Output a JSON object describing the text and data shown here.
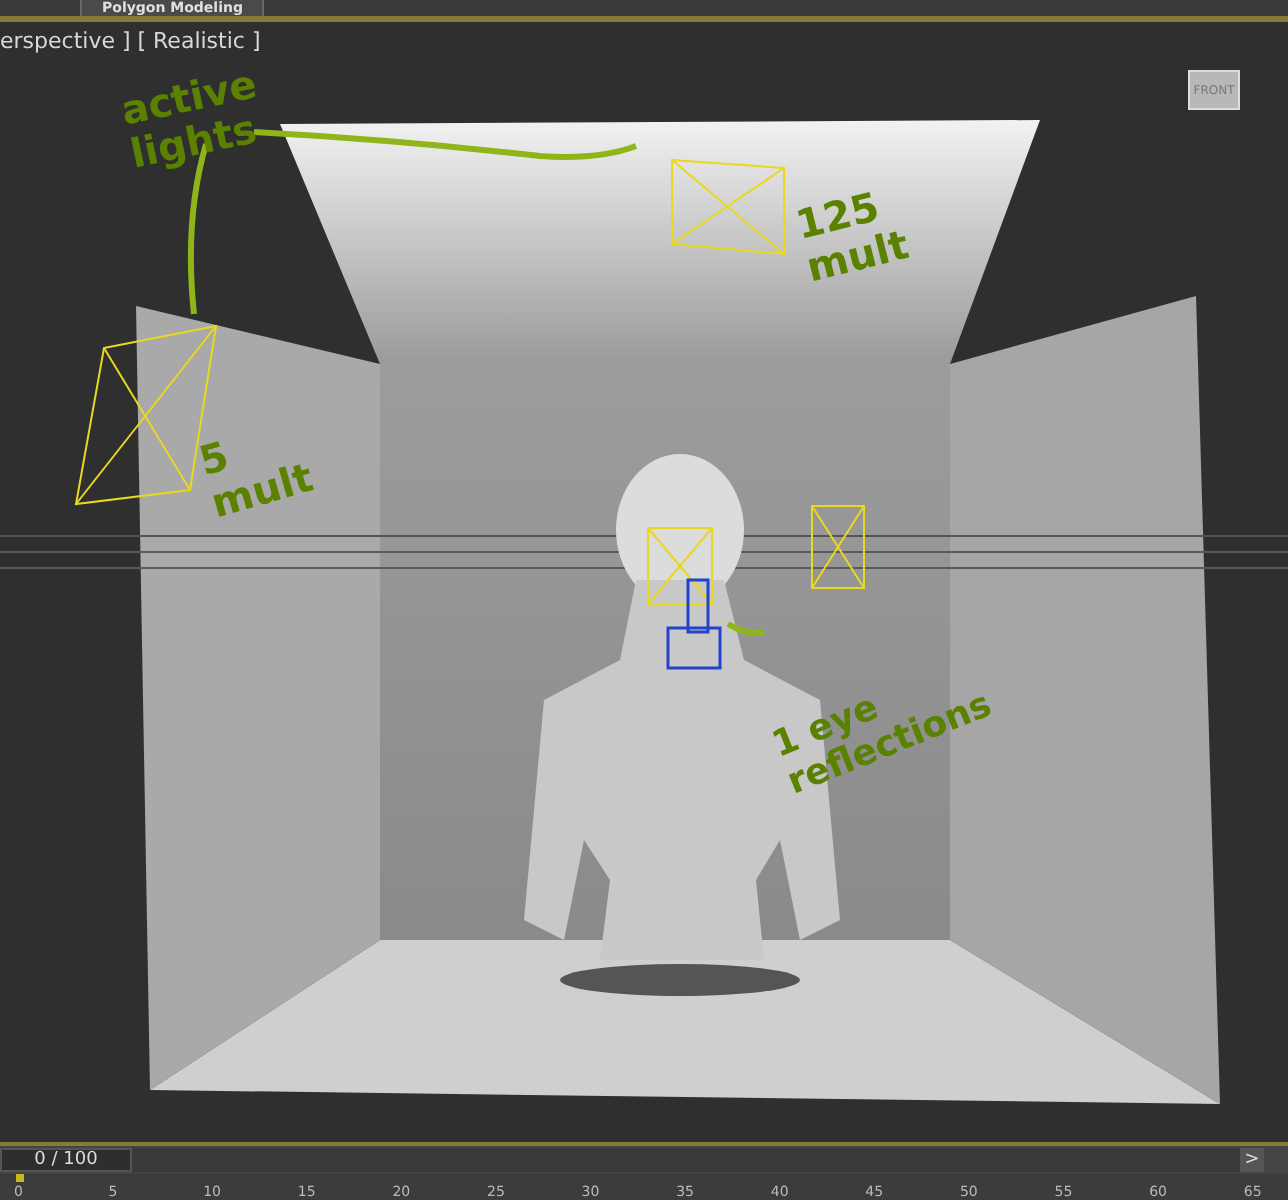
{
  "ribbon": {
    "tab": "Polygon Modeling"
  },
  "viewport": {
    "label": "erspective ] [ Realistic ]",
    "viewcube": "FRONT",
    "annotations": [
      {
        "text": "active lights"
      },
      {
        "text": "125 mult"
      },
      {
        "text": "5 mult"
      },
      {
        "text": "1 eye reflections"
      }
    ]
  },
  "timeline": {
    "frame": "0 / 100",
    "next": ">",
    "level": 0
  },
  "ruler": {
    "ticks": [
      "0",
      "5",
      "10",
      "15",
      "20",
      "25",
      "30",
      "35",
      "40",
      "45",
      "50",
      "55",
      "60",
      "65"
    ]
  }
}
